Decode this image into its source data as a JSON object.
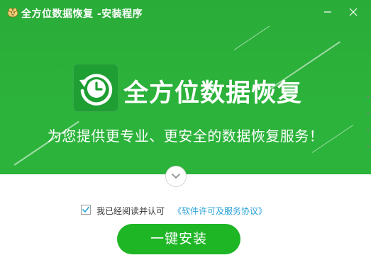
{
  "window": {
    "title": "全方位数据恢复 -安装程序"
  },
  "banner": {
    "product_name": "全方位数据恢复",
    "slogan": "为您提供更专业、更安全的数据恢复服务！"
  },
  "agreement": {
    "checked": true,
    "text": "我已经阅读并认可",
    "link_text": "《软件许可及服务协议》"
  },
  "install_button": {
    "label": "一键安装"
  },
  "colors": {
    "brand_green": "#2cb33b",
    "button_green": "#1fb626",
    "link_blue": "#2aa2d8"
  },
  "icons": {
    "app": "app-logo-icon",
    "minimize": "minimize-icon",
    "close": "close-icon",
    "logo": "data-recovery-clock-icon",
    "expand": "chevron-down-icon",
    "check": "checkmark-icon"
  }
}
